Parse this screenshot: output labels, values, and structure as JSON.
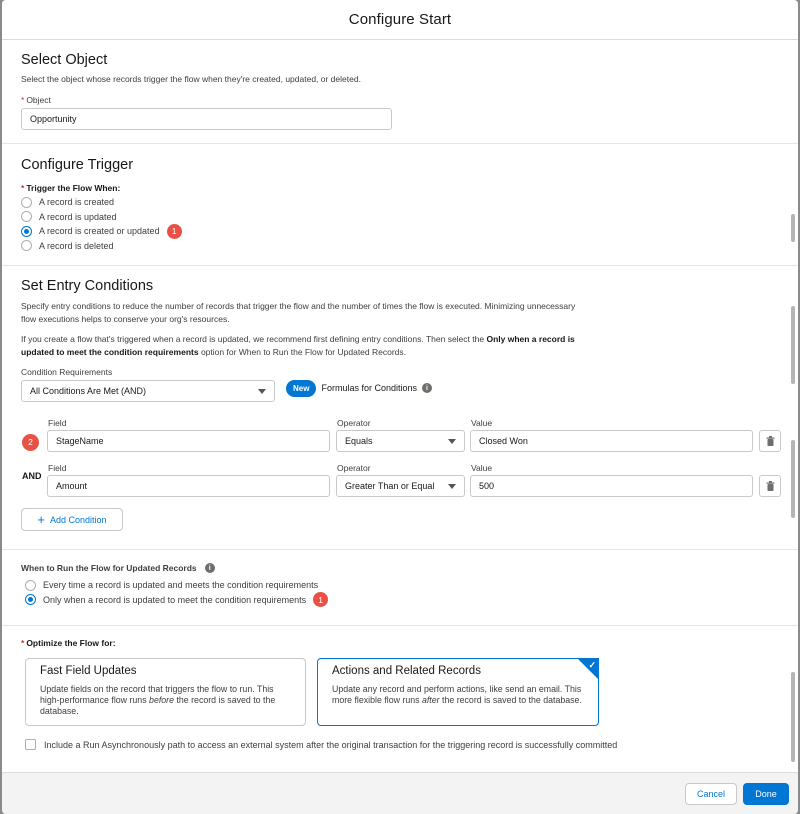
{
  "modal": {
    "title": "Configure Start"
  },
  "select_object": {
    "title": "Select Object",
    "help": "Select the object whose records trigger the flow when they're created, updated, or deleted.",
    "field_label": "Object",
    "value": "Opportunity"
  },
  "configure_trigger": {
    "title": "Configure Trigger",
    "label": "Trigger the Flow When:",
    "options": [
      "A record is created",
      "A record is updated",
      "A record is created or updated",
      "A record is deleted"
    ],
    "selected": "A record is created or updated",
    "badge": "1"
  },
  "entry_conditions": {
    "title": "Set Entry Conditions",
    "help1": "Specify entry conditions to reduce the number of records that trigger the flow and the number of times the flow is executed. Minimizing unnecessary flow executions helps to conserve your org's resources.",
    "help2_a": "If you create a flow that's triggered when a record is updated, we recommend first defining entry conditions. Then select the",
    "help2_bold": "Only when a record is updated to meet the condition requirements",
    "help2_b": "option for When to Run the Flow for Updated Records.",
    "requirements_label": "Condition Requirements",
    "requirements_value": "All Conditions Are Met (AND)",
    "new_pill": "New",
    "formulas_label": "Formulas for Conditions",
    "row_badge": "2",
    "field_label": "Field",
    "operator_label": "Operator",
    "value_label": "Value",
    "and_label": "AND",
    "rows": [
      {
        "field": "StageName",
        "operator": "Equals",
        "value": "Closed Won"
      },
      {
        "field": "Amount",
        "operator": "Greater Than or Equal",
        "value": "500"
      }
    ],
    "add_condition": "Add Condition"
  },
  "when_to_run": {
    "label": "When to Run the Flow for Updated Records",
    "options": [
      "Every time a record is updated and meets the condition requirements",
      "Only when a record is updated to meet the condition requirements"
    ],
    "selected": "Only when a record is updated to meet the condition requirements",
    "badge": "1"
  },
  "optimize": {
    "label": "Optimize the Flow for:",
    "fast": {
      "title": "Fast Field Updates",
      "text_a": "Update fields on the record that triggers the flow to run. This high-performance flow runs",
      "text_em": "before",
      "text_b": "the record is saved to the database."
    },
    "actions": {
      "title": "Actions and Related Records",
      "text_a": "Update any record and perform actions, like send an email. This more flexible flow runs",
      "text_em": "after",
      "text_b": "the record is saved to the database."
    },
    "selected": "Actions and Related Records",
    "async_label": "Include a Run Asynchronously path to access an external system after the original transaction for the triggering record is successfully committed"
  },
  "footer": {
    "cancel": "Cancel",
    "done": "Done"
  },
  "colors": {
    "brand": "#0176d3",
    "badge": "#ea5146",
    "required": "#c23934"
  }
}
